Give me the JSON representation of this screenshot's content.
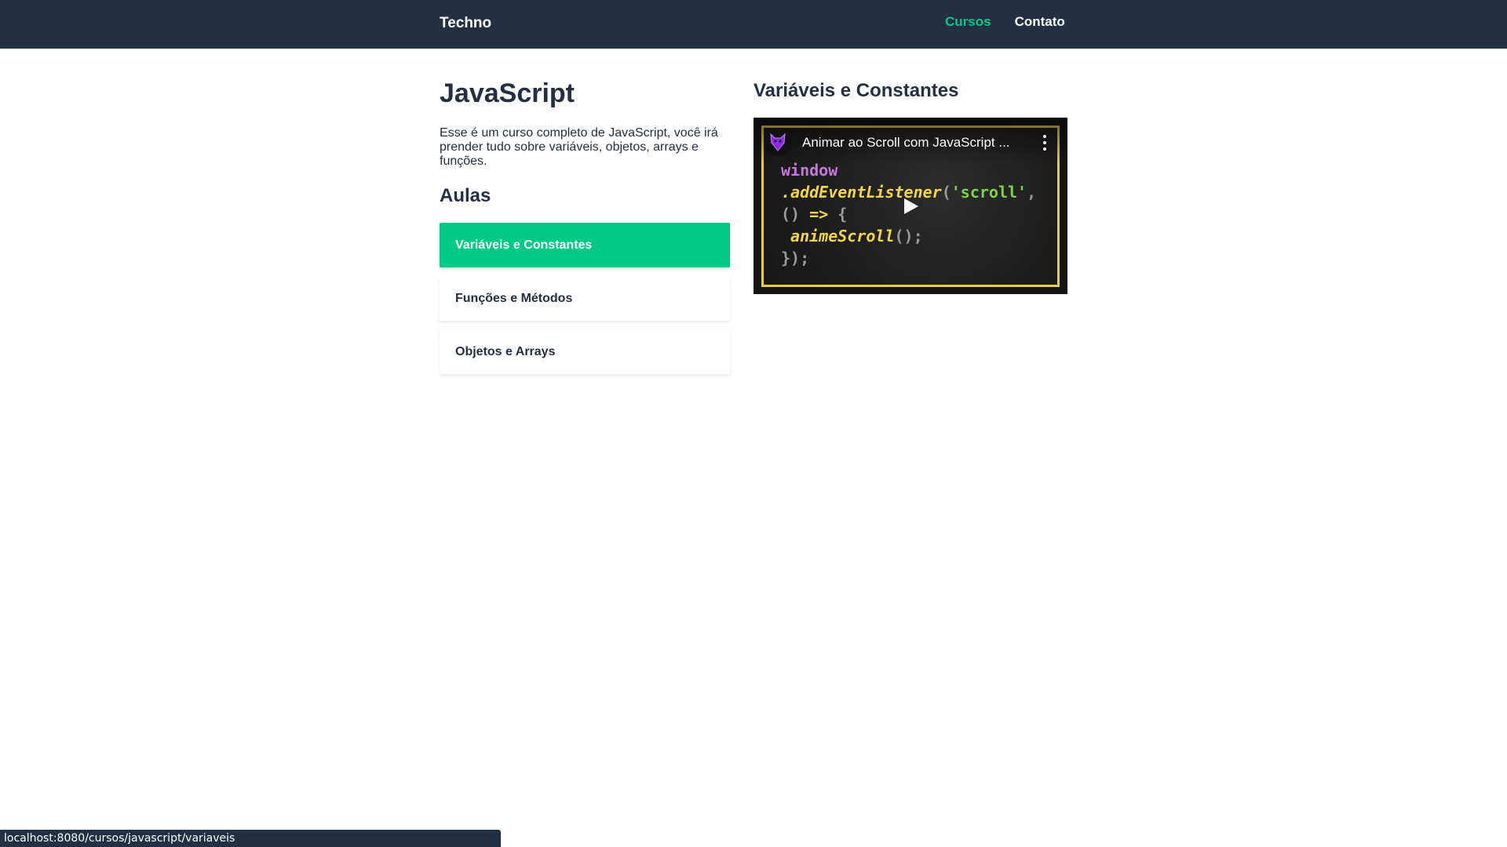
{
  "header": {
    "brand": "Techno",
    "nav": [
      {
        "label": "Cursos",
        "active": true
      },
      {
        "label": "Contato",
        "active": false
      }
    ]
  },
  "course": {
    "title": "JavaScript",
    "description": "Esse é um curso completo de JavaScript, você irá prender tudo sobre variáveis, objetos, arrays e funções.",
    "lessons_heading": "Aulas",
    "lessons": [
      {
        "label": "Variáveis e Constantes",
        "active": true
      },
      {
        "label": "Funções e Métodos",
        "active": false
      },
      {
        "label": "Objetos e Arrays",
        "active": false
      }
    ]
  },
  "lesson": {
    "title": "Variáveis e Constantes",
    "video": {
      "title": "Animar ao Scroll com JavaScript ...",
      "thumbnail_code": {
        "line1": "window",
        "line2_fn": ".addEventListener",
        "line2_open": "(",
        "line2_str": "'scroll'",
        "line2_comma": ",",
        "line3_parens": "()",
        "line3_arrow": " => ",
        "line3_brace": "{",
        "line4_fn": " animeScroll",
        "line4_call": "();",
        "line5": "});"
      }
    }
  },
  "statusbar": {
    "url": "localhost:8080/cursos/javascript/variaveis"
  },
  "colors": {
    "dark": "#233044",
    "accent": "#00c985",
    "white": "#ffffff"
  },
  "icons": {
    "channel_avatar": "wolf-logo-icon",
    "menu": "kebab-menu-icon",
    "play": "play-icon"
  }
}
